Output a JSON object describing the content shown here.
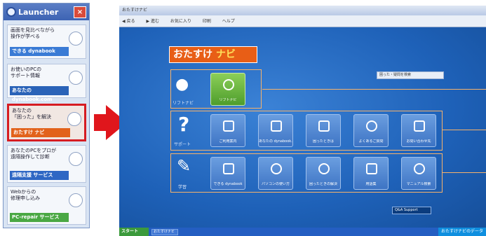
{
  "launcher": {
    "title": "Launcher",
    "close_glyph": "×",
    "cards": [
      {
        "text": "画面を見比べながら\n操作が学べる",
        "tag": "できる dynabook",
        "tag_color": "#3a7bd5"
      },
      {
        "text": "お使いのPCの\nサポート情報",
        "tag": "あなたの dynabook.com",
        "tag_color": "#2a63b8"
      },
      {
        "text": "あなたの\n「困った」を解決",
        "tag": "おたすけ ナビ",
        "tag_color": "#e2621b"
      },
      {
        "text": "あなたのPCをプロが\n遠隔操作して診断",
        "tag": "遠隔支援 サービス",
        "tag_color": "#2e67c4"
      },
      {
        "text": "Webからの\n修理申し込み",
        "tag": "PC-repair サービス",
        "tag_color": "#4aa844"
      }
    ]
  },
  "window": {
    "title": "おたすけナビ",
    "toolbar": [
      "◀ 戻る",
      "▶ 進む",
      "お気に入り",
      "印刷",
      "ヘルプ"
    ],
    "banner_main": "おたすけ",
    "banner_accent": "ナビ",
    "search_placeholder": "困った・疑問を検索",
    "sections": [
      {
        "label": "リフトナビ",
        "big": "●",
        "tiles": [
          {
            "label": "リフトナビ"
          }
        ]
      },
      {
        "label": "サポート",
        "big": "?",
        "tiles": [
          {
            "label": "ご利用案内"
          },
          {
            "label": "あなたの dynabook.com"
          },
          {
            "label": "困ったときは"
          },
          {
            "label": "よくあるご質問"
          },
          {
            "label": "お問い合わせ先"
          }
        ]
      },
      {
        "label": "学習",
        "big": "✎",
        "tiles": [
          {
            "label": "できる dynabook"
          },
          {
            "label": "パソコンの使い方"
          },
          {
            "label": "困ったときの解決"
          },
          {
            "label": "用語集"
          },
          {
            "label": "マニュアル検索"
          }
        ]
      }
    ],
    "info_badge": "Q&A Support",
    "taskbar": {
      "start": "スタート",
      "item": "おたすけナビ",
      "tray": "おたすけナビのデータ"
    }
  },
  "colors": {
    "accent": "#e0161c",
    "background": "#1f5fae",
    "frame": "#f6b26b"
  }
}
